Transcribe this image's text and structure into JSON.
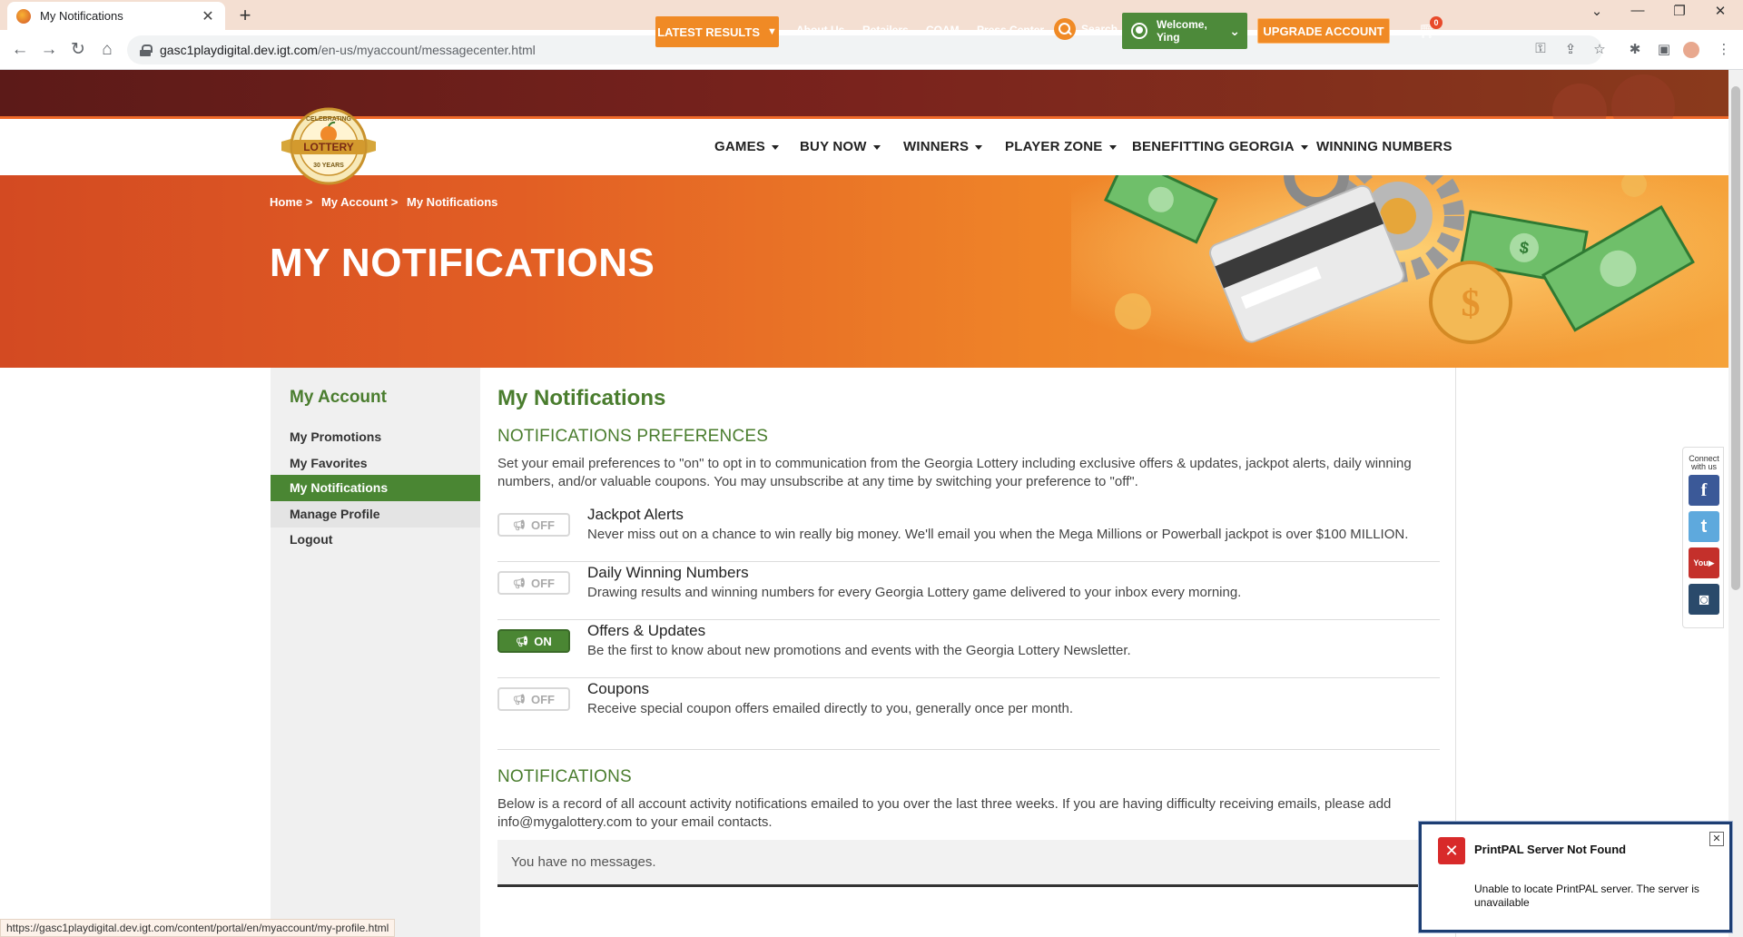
{
  "browser": {
    "tab_title": "My Notifications",
    "url_host": "gasc1playdigital.dev.igt.com",
    "url_path": "/en-us/myaccount/messagecenter.html",
    "status_url": "https://gasc1playdigital.dev.igt.com/content/portal/en/myaccount/my-profile.html"
  },
  "topbar": {
    "latest_results": "LATEST RESULTS",
    "links": [
      "About Us",
      "Retailers",
      "COAM",
      "Press Center"
    ],
    "search": "Search",
    "welcome_line1": "Welcome,",
    "welcome_line2": "Ying",
    "upgrade": "UPGRADE ACCOUNT",
    "cart_count": "0"
  },
  "logo": {
    "top_text": "CELEBRATING",
    "main_text": "LOTTERY",
    "bottom_text": "30 YEARS"
  },
  "nav": [
    "GAMES",
    "BUY NOW",
    "WINNERS",
    "PLAYER ZONE",
    "BENEFITTING GEORGIA",
    "WINNING NUMBERS"
  ],
  "hero": {
    "breadcrumb": [
      "Home",
      ">",
      "My Account",
      ">",
      "My Notifications"
    ],
    "title": "MY NOTIFICATIONS"
  },
  "sidebar": {
    "title": "My Account",
    "items": [
      "My Promotions",
      "My Favorites",
      "My Notifications",
      "Manage Profile",
      "Logout"
    ]
  },
  "content": {
    "title": "My Notifications",
    "prefs_heading": "NOTIFICATIONS PREFERENCES",
    "prefs_intro": "Set your email preferences to \"on\" to opt in to communication from the Georgia Lottery including exclusive offers & updates, jackpot alerts, daily winning numbers, and/or valuable coupons. You may unsubscribe at any time by switching your preference to \"off\".",
    "prefs": [
      {
        "state": "OFF",
        "name": "Jackpot Alerts",
        "desc": "Never miss out on a chance to win really big money. We'll email you when the Mega Millions or Powerball jackpot is over $100 MILLION."
      },
      {
        "state": "OFF",
        "name": "Daily Winning Numbers",
        "desc": "Drawing results and winning numbers for every Georgia Lottery game delivered to your inbox every morning."
      },
      {
        "state": "ON",
        "name": "Offers & Updates",
        "desc": "Be the first to know about new promotions and events with the Georgia Lottery Newsletter."
      },
      {
        "state": "OFF",
        "name": "Coupons",
        "desc": "Receive special coupon offers emailed directly to you, generally once per month."
      }
    ],
    "notif_heading": "NOTIFICATIONS",
    "notif_intro": "Below is a record of all account activity notifications emailed to you over the last three weeks. If you are having difficulty receiving emails, please add info@mygalottery.com to your email contacts.",
    "no_messages": "You have no messages."
  },
  "social": {
    "connect_line1": "Connect",
    "connect_line2": "with us",
    "colors": {
      "facebook": "#3b5998",
      "twitter": "#5ea9dd",
      "youtube": "#c4302b",
      "instagram": "#2a4a6b"
    }
  },
  "toast": {
    "title": "PrintPAL Server Not Found",
    "message": "Unable to locate PrintPAL server. The server is unavailable"
  }
}
